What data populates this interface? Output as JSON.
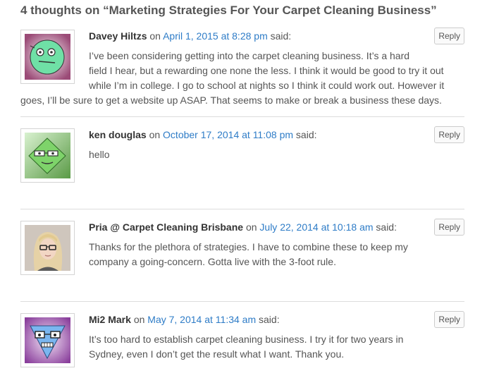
{
  "heading": "4 thoughts on “Marketing Strategies For Your Carpet Cleaning Business”",
  "reply_label": "Reply",
  "said": "said:",
  "on": "on",
  "comments": [
    {
      "author": "Davey Hiltzs",
      "date": "April 1, 2015 at 8:28 pm",
      "lines": [
        "I’ve been considering getting into the carpet cleaning business. It’s a hard",
        "field I hear, but a rewarding one none the less. I think it would be good to try it out",
        "while I’m in college. I go to school at nights so I think it could work out. However it",
        "goes, I’ll be sure to get a website up ASAP. That seems to make or break a business these days."
      ],
      "avatar": "green-robot-avatar"
    },
    {
      "author": "ken douglas",
      "date": "October 17, 2014 at 11:08 pm",
      "lines": [
        "hello"
      ],
      "avatar": "green-diamond-glasses-avatar"
    },
    {
      "author": "Pria @ Carpet Cleaning Brisbane",
      "date": "July 22, 2014 at 10:18 am",
      "lines": [
        "Thanks for the plethora of strategies. I have to combine these to keep my",
        "company a going-concern. Gotta live with the 3-foot rule."
      ],
      "avatar": "photo-woman-glasses-avatar"
    },
    {
      "author": "Mi2 Mark",
      "date": "May 7, 2014 at 11:34 am",
      "lines": [
        "It’s too hard to establish carpet cleaning business. I try it for two years in",
        "Sydney, even I don’t get the result what I want. Thank you."
      ],
      "avatar": "purple-triangle-avatar"
    }
  ],
  "colors": {
    "link": "#2e7cc7",
    "text": "#555555",
    "author": "#333333",
    "divider": "#dddddd"
  }
}
